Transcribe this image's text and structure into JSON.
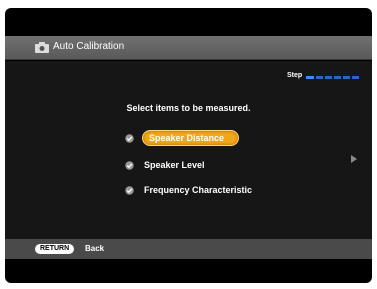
{
  "header": {
    "title": "Auto Calibration",
    "icon": "receiver-icon"
  },
  "step": {
    "label": "Step",
    "total_steps": 6,
    "current_step": 1
  },
  "main": {
    "instruction": "Select items to be measured.",
    "items": [
      {
        "label": "Speaker Distance",
        "checked": true,
        "selected": true
      },
      {
        "label": "Speaker Level",
        "checked": true,
        "selected": false
      },
      {
        "label": "Frequency Characteristic",
        "checked": true,
        "selected": false
      }
    ]
  },
  "footer": {
    "button_label": "RETURN",
    "action_label": "Back"
  },
  "colors": {
    "highlight": "#f2a71a",
    "step_active": "#3d8af0",
    "step_inactive": "#2a66c8",
    "header_bar": "#666666",
    "footer_bar": "#4a4a4a"
  }
}
